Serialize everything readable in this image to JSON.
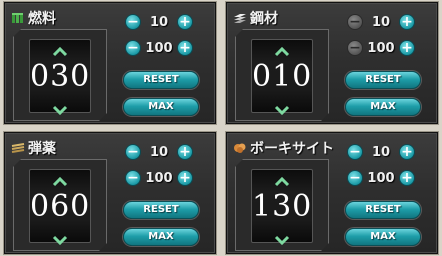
{
  "panels": [
    {
      "title": "燃料",
      "icon": "fuel-icon",
      "value": "030",
      "step_small": "10",
      "step_large": "100",
      "reset_label": "RESET",
      "max_label": "MAX",
      "minus_active": true
    },
    {
      "title": "鋼材",
      "icon": "steel-icon",
      "value": "010",
      "step_small": "10",
      "step_large": "100",
      "reset_label": "RESET",
      "max_label": "MAX",
      "minus_active": false
    },
    {
      "title": "弾薬",
      "icon": "ammo-icon",
      "value": "060",
      "step_small": "10",
      "step_large": "100",
      "reset_label": "RESET",
      "max_label": "MAX",
      "minus_active": true
    },
    {
      "title": "ボーキサイト",
      "icon": "bauxite-icon",
      "value": "130",
      "step_small": "10",
      "step_large": "100",
      "reset_label": "RESET",
      "max_label": "MAX",
      "minus_active": true
    }
  ],
  "colors": {
    "accent": "#1e9ea9",
    "panel_bg": "#2e2e2e",
    "arrow": "#7ed9a0",
    "page_bg": "#d9d4c8"
  }
}
